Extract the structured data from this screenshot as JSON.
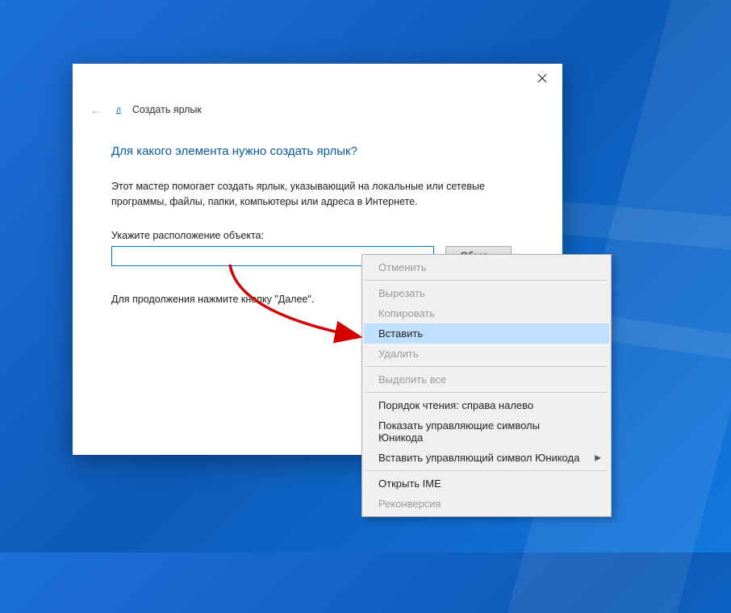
{
  "window": {
    "breadcrumb": "Создать ярлык",
    "heading": "Для какого элемента нужно создать ярлык?",
    "description": "Этот мастер помогает создать ярлык, указывающий на локальные или сетевые программы, файлы, папки, компьютеры или адреса в Интернете.",
    "field_label": "Укажите расположение объекта:",
    "input_value": "",
    "browse_label": "Обзор...",
    "continue_text": "Для продолжения нажмите кнопку \"Далее\"."
  },
  "context_menu": {
    "items": [
      {
        "label": "Отменить",
        "disabled": true
      },
      {
        "sep": true
      },
      {
        "label": "Вырезать",
        "disabled": true
      },
      {
        "label": "Копировать",
        "disabled": true
      },
      {
        "label": "Вставить",
        "highlighted": true
      },
      {
        "label": "Удалить",
        "disabled": true
      },
      {
        "sep": true
      },
      {
        "label": "Выделить все",
        "disabled": true
      },
      {
        "sep": true
      },
      {
        "label": "Порядок чтения: справа налево"
      },
      {
        "label": "Показать управляющие символы Юникода"
      },
      {
        "label": "Вставить управляющий символ Юникода",
        "submenu": true
      },
      {
        "sep": true
      },
      {
        "label": "Открыть IME"
      },
      {
        "label": "Реконверсия",
        "disabled": true
      }
    ]
  }
}
